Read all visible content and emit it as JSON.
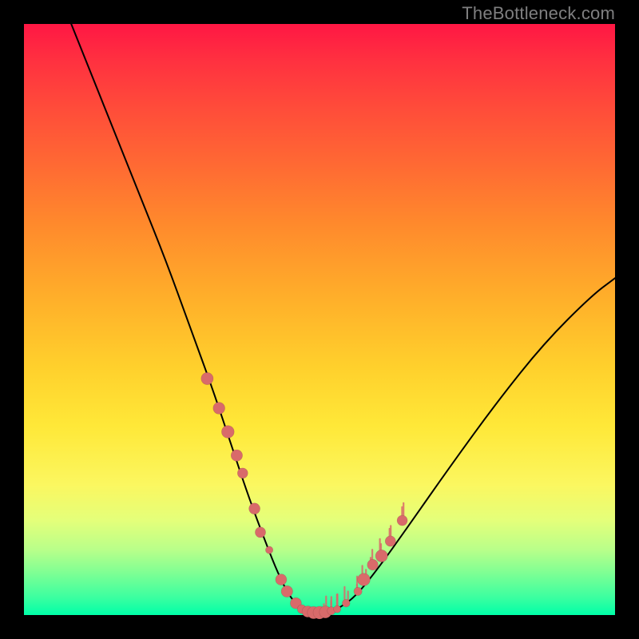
{
  "watermark": "TheBottleneck.com",
  "chart_data": {
    "type": "line",
    "title": "",
    "xlabel": "",
    "ylabel": "",
    "xlim": [
      0,
      100
    ],
    "ylim": [
      0,
      100
    ],
    "background_gradient": [
      "#ff1744",
      "#ffae2a",
      "#fbf760",
      "#00ffa8"
    ],
    "curve_color": "#000000",
    "marker_color": "#d96a6a",
    "series": [
      {
        "name": "bottleneck-curve",
        "x": [
          8,
          12,
          16,
          20,
          24,
          28,
          32,
          35,
          38,
          41,
          43,
          45,
          47,
          49,
          51,
          53,
          56,
          60,
          65,
          72,
          80,
          88,
          96,
          100
        ],
        "y": [
          100,
          90,
          80,
          70,
          60,
          49,
          38,
          29,
          20,
          12,
          7,
          3,
          1,
          0,
          0,
          1,
          3,
          8,
          15,
          25,
          36,
          46,
          54,
          57
        ]
      }
    ],
    "markers": {
      "name": "scatter-points",
      "x": [
        31,
        33,
        34.5,
        36,
        37,
        39,
        40,
        41.5,
        43.5,
        44.5,
        46,
        47,
        48,
        49,
        50,
        51,
        52,
        53,
        54.5,
        56.5,
        57.5,
        59,
        60.5,
        62,
        64
      ],
      "y": [
        40,
        35,
        31,
        27,
        24,
        18,
        14,
        11,
        6,
        4,
        2,
        1,
        0.6,
        0.4,
        0.4,
        0.5,
        0.7,
        1,
        2,
        4,
        6,
        8.5,
        10,
        12.5,
        16
      ]
    }
  }
}
